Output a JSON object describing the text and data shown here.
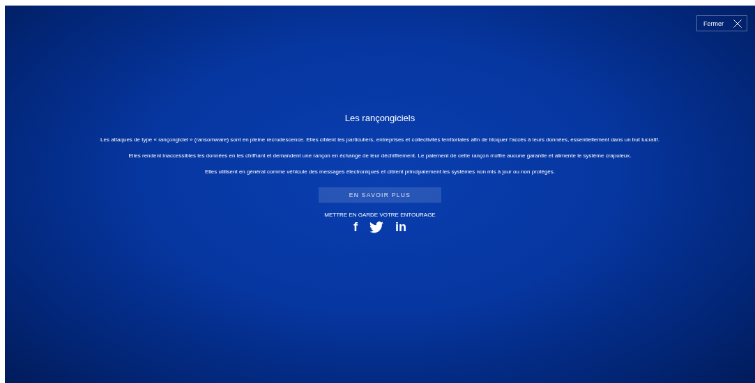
{
  "close_button": {
    "label": "Fermer"
  },
  "title": "Les rançongiciels",
  "paragraphs": [
    "Les attaques de type « rançongiciel » (ransomware) sont en pleine recrudescence. Elles ciblent les particuliers, entreprises et collectivités territoriales afin de bloquer l'accès à leurs données, essentiellement dans un but lucratif.",
    "Elles rendent inaccessibles les données en les chiffrant et demandent une rançon en échange de leur déchiffrement. Le paiement de cette rançon n'offre aucune garantie et alimente le système crapuleux.",
    "Elles utilisent en général comme véhicule des messages électroniques et ciblent principalement les systèmes non mis à jour ou non protégés."
  ],
  "cta_button": "EN SAVOIR PLUS",
  "share": {
    "label": "METTRE EN GARDE VOTRE ENTOURAGE",
    "links": [
      {
        "kind": "text",
        "text": "f"
      },
      {
        "kind": "bird"
      },
      {
        "kind": "text",
        "text": "in"
      }
    ]
  }
}
